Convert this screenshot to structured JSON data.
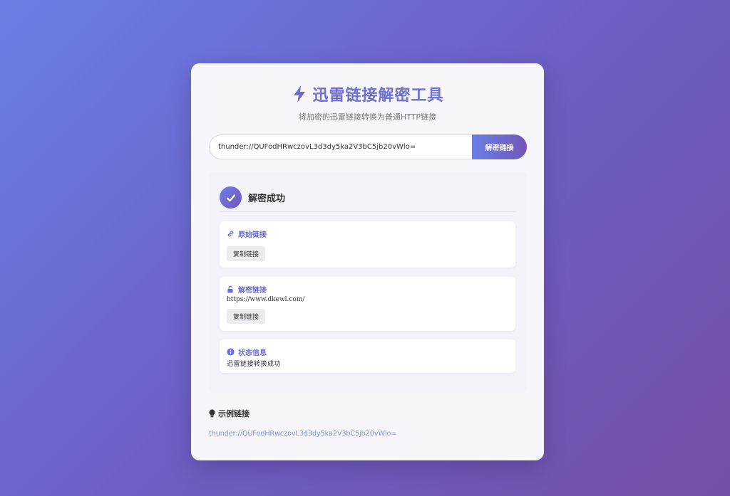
{
  "header": {
    "title": "迅雷链接解密工具",
    "subtitle": "将加密的迅雷链接转换为普通HTTP链接",
    "icon": "lightning-icon"
  },
  "input": {
    "value": "thunder://QUFodHRwczovL3d3dy5ka2V3bC5jb20vWlo=",
    "button_label": "解密链接"
  },
  "result": {
    "status_title": "解密成功",
    "original": {
      "label": "原始链接",
      "value": "",
      "copy_label": "复制链接"
    },
    "decrypted": {
      "label": "解密链接",
      "value": "https://www.dkewl.com/",
      "copy_label": "复制链接"
    },
    "info": {
      "label": "状态信息",
      "value": "迅雷链接转换成功"
    }
  },
  "examples": {
    "title": "示例链接",
    "links": [
      "thunder://QUFodHRwczovL3d3dy5ka2V3bC5jb20vWlo="
    ]
  },
  "colors": {
    "accent": "#6e6fd0",
    "link": "#7b8ee6"
  }
}
